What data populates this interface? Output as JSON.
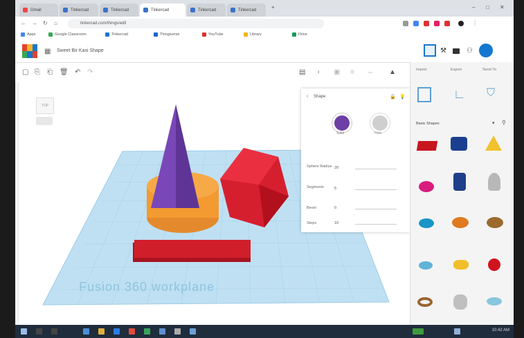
{
  "browser": {
    "tabs": [
      {
        "label": "Gmail"
      },
      {
        "label": "Tinkercad"
      },
      {
        "label": "Tinkercad"
      },
      {
        "label": "Tinkercad"
      },
      {
        "label": "Tinkercad"
      },
      {
        "label": "Tinkercad"
      }
    ],
    "url": "tinkercad.com/things/edit",
    "bookmarks": [
      {
        "label": "Apps",
        "color": "#4285f4"
      },
      {
        "label": "Google Classroom",
        "color": "#34a853"
      },
      {
        "label": "Tinkercad",
        "color": "#1477d1"
      },
      {
        "label": "Thingiverse",
        "color": "#1b65c6"
      },
      {
        "label": "YouTube",
        "color": "#e02f2f"
      },
      {
        "label": "Library",
        "color": "#f4b400"
      },
      {
        "label": "Drive",
        "color": "#0f9d58"
      }
    ]
  },
  "app": {
    "design_name": "Sweet Bir Kasi Shape",
    "accent": "#1477d1"
  },
  "workplane": {
    "view_label": "TOP",
    "watermark": "Fusion 360 workplane"
  },
  "inspector": {
    "title": "Shape",
    "solid_label": "Solid",
    "hole_label": "Hole",
    "solid_color": "#6b3fa6",
    "properties": [
      {
        "label": "Sphere Radius",
        "value": "20"
      },
      {
        "label": "Segments",
        "value": "5"
      },
      {
        "label": "Bevel",
        "value": "0"
      },
      {
        "label": "Steps",
        "value": "10"
      }
    ]
  },
  "panel": {
    "tabs": [
      "Import",
      "Export",
      "Send To"
    ],
    "category": "Basic Shapes",
    "shape_icons": [
      "box-icon",
      "cylinder-icon",
      "pyramid-icon",
      "sphere-icon",
      "tube-icon",
      "cone-icon",
      "torus-icon",
      "roof-icon",
      "wedge-icon",
      "star-icon",
      "heart-icon",
      "half-sphere-icon",
      "ring-icon",
      "gem-icon",
      "paraboloid-icon"
    ]
  },
  "taskbar": {
    "time": "10:42 AM"
  }
}
